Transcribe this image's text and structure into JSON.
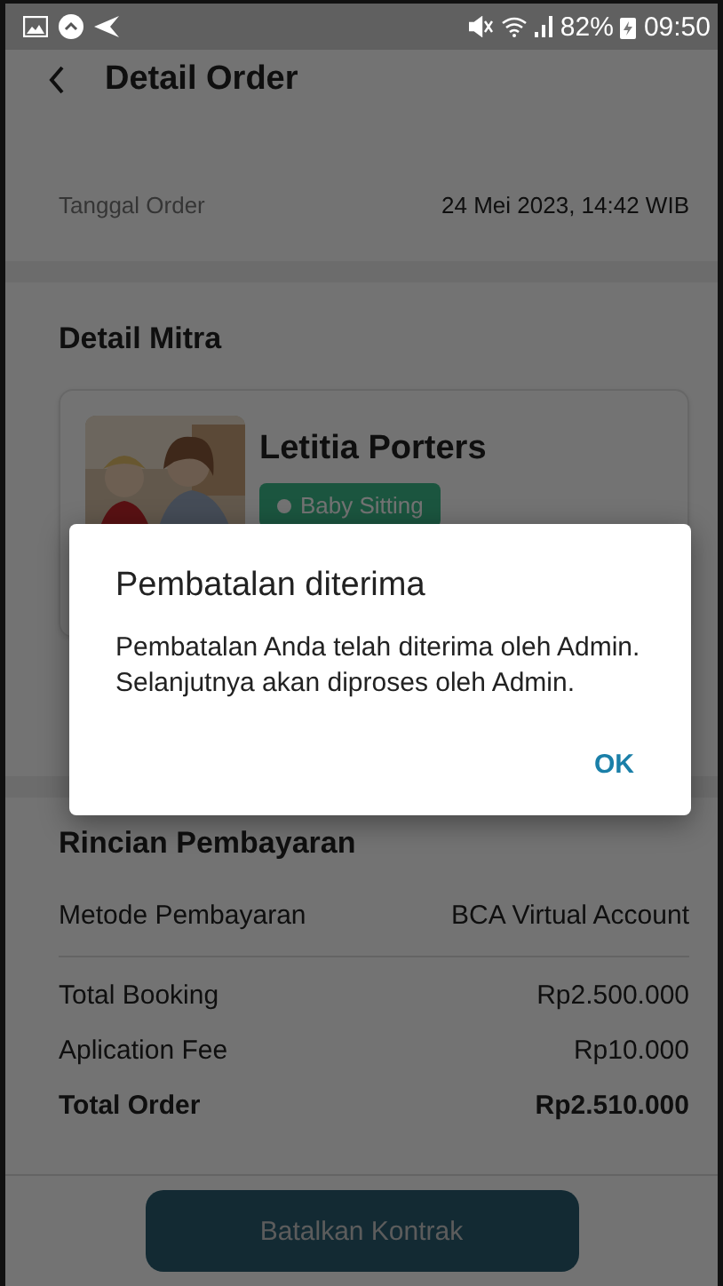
{
  "status_bar": {
    "battery": "82%",
    "time": "09:50"
  },
  "header": {
    "title": "Detail Order"
  },
  "order_info": [
    {
      "label": "Tanggal Order",
      "value": "24 Mei 2023, 14:42 WIB"
    }
  ],
  "partner": {
    "heading": "Detail Mitra",
    "name": "Letitia Porters",
    "service": "Baby Sitting"
  },
  "payment": {
    "heading": "Rincian Pembayaran",
    "method": {
      "label": "Metode Pembayaran",
      "value": "BCA Virtual Account"
    },
    "lines": [
      {
        "label": "Total Booking",
        "value": "Rp2.500.000",
        "bold": false
      },
      {
        "label": "Aplication Fee",
        "value": "Rp10.000",
        "bold": false
      },
      {
        "label": "Total Order",
        "value": "Rp2.510.000",
        "bold": true
      }
    ]
  },
  "action_button": "Batalkan Kontrak",
  "dialog": {
    "title": "Pembatalan diterima",
    "message": "Pembatalan Anda telah diterima oleh Admin. Selanjutnya akan diproses oleh Admin.",
    "button": "OK"
  }
}
